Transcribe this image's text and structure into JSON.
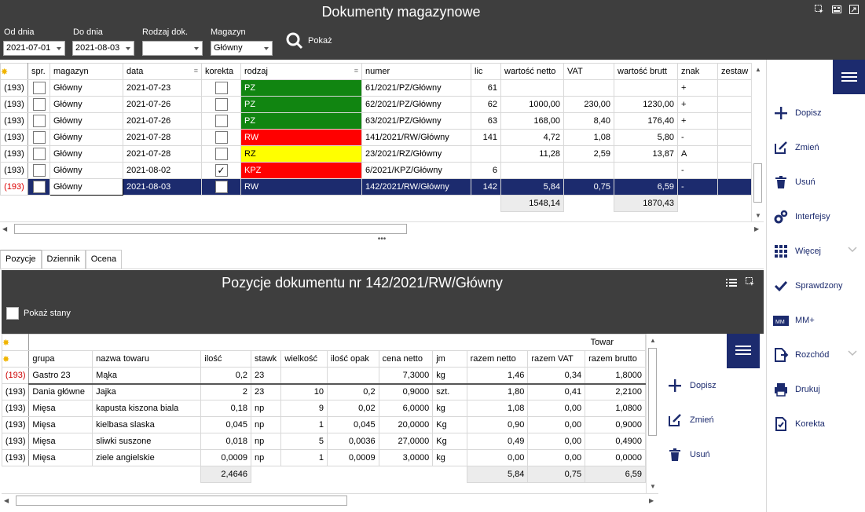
{
  "header": {
    "title": "Dokumenty magazynowe",
    "filters": {
      "from_label": "Od dnia",
      "from_value": "2021-07-01",
      "to_label": "Do dnia",
      "to_value": "2021-08-03",
      "type_label": "Rodzaj dok.",
      "type_value": "",
      "warehouse_label": "Magazyn",
      "warehouse_value": "Główny"
    },
    "show_label": "Pokaż"
  },
  "docs": {
    "columns": [
      "spr.",
      "magazyn",
      "data",
      "korekta",
      "rodzaj",
      "numer",
      "lic",
      "wartość netto",
      "VAT",
      "wartość brutt",
      "znak",
      "zestaw"
    ],
    "rows": [
      {
        "rh": "(193)",
        "magazyn": "Główny",
        "data": "2021-07-23",
        "korekta": "",
        "rodzaj": "PZ",
        "numer": "61/2021/PZ/Główny",
        "lic": "61",
        "netto": "",
        "vat": "",
        "brutto": "",
        "znak": "+"
      },
      {
        "rh": "(193)",
        "magazyn": "Główny",
        "data": "2021-07-26",
        "korekta": "",
        "rodzaj": "PZ",
        "numer": "62/2021/PZ/Główny",
        "lic": "62",
        "netto": "1000,00",
        "vat": "230,00",
        "brutto": "1230,00",
        "znak": "+"
      },
      {
        "rh": "(193)",
        "magazyn": "Główny",
        "data": "2021-07-26",
        "korekta": "",
        "rodzaj": "PZ",
        "numer": "63/2021/PZ/Główny",
        "lic": "63",
        "netto": "168,00",
        "vat": "8,40",
        "brutto": "176,40",
        "znak": "+"
      },
      {
        "rh": "(193)",
        "magazyn": "Główny",
        "data": "2021-07-28",
        "korekta": "",
        "rodzaj": "RW",
        "numer": "141/2021/RW/Główny",
        "lic": "141",
        "netto": "4,72",
        "vat": "1,08",
        "brutto": "5,80",
        "znak": "-"
      },
      {
        "rh": "(193)",
        "magazyn": "Główny",
        "data": "2021-07-28",
        "korekta": "",
        "rodzaj": "RZ",
        "numer": "23/2021/RZ/Główny",
        "lic": "",
        "netto": "11,28",
        "vat": "2,59",
        "brutto": "13,87",
        "znak": "A"
      },
      {
        "rh": "(193)",
        "magazyn": "Główny",
        "data": "2021-08-02",
        "korekta": "✓",
        "rodzaj": "KPZ",
        "numer": "6/2021/KPZ/Główny",
        "lic": "6",
        "netto": "",
        "vat": "",
        "brutto": "",
        "znak": "-"
      },
      {
        "rh": "(193)",
        "magazyn": "Główny",
        "data": "2021-08-03",
        "korekta": "",
        "rodzaj": "RW",
        "numer": "142/2021/RW/Główny",
        "lic": "142",
        "netto": "5,84",
        "vat": "0,75",
        "brutto": "6,59",
        "znak": "-"
      }
    ],
    "totals": {
      "netto": "1548,14",
      "brutto": "1870,43"
    }
  },
  "tabs": [
    "Pozycje",
    "Dziennik",
    "Ocena"
  ],
  "positions": {
    "title": "Pozycje dokumentu nr 142/2021/RW/Główny",
    "show_stock_label": "Pokaż stany",
    "group_header": "Towar",
    "columns": [
      "grupa",
      "nazwa towaru",
      "ilość",
      "stawk",
      "wielkość",
      "ilość opak",
      "cena netto",
      "jm",
      "razem netto",
      "razem VAT",
      "razem brutto"
    ],
    "rows": [
      {
        "rh": "(193)",
        "grupa": "Gastro 23",
        "nazwa": "Mąka",
        "ilosc": "0,2",
        "stawka": "23",
        "wielkosc": "",
        "opak": "",
        "cena": "7,3000",
        "jm": "kg",
        "rn": "1,46",
        "rv": "0,34",
        "rb": "1,8000"
      },
      {
        "rh": "(193)",
        "grupa": "Dania główne",
        "nazwa": "Jajka",
        "ilosc": "2",
        "stawka": "23",
        "wielkosc": "10",
        "opak": "0,2",
        "cena": "0,9000",
        "jm": "szt.",
        "rn": "1,80",
        "rv": "0,41",
        "rb": "2,2100"
      },
      {
        "rh": "(193)",
        "grupa": "Mięsa",
        "nazwa": "kapusta kiszona biala",
        "ilosc": "0,18",
        "stawka": "np",
        "wielkosc": "9",
        "opak": "0,02",
        "cena": "6,0000",
        "jm": "kg",
        "rn": "1,08",
        "rv": "0,00",
        "rb": "1,0800"
      },
      {
        "rh": "(193)",
        "grupa": "Mięsa",
        "nazwa": "kielbasa slaska",
        "ilosc": "0,045",
        "stawka": "np",
        "wielkosc": "1",
        "opak": "0,045",
        "cena": "20,0000",
        "jm": "Kg",
        "rn": "0,90",
        "rv": "0,00",
        "rb": "0,9000"
      },
      {
        "rh": "(193)",
        "grupa": "Mięsa",
        "nazwa": "sliwki suszone",
        "ilosc": "0,018",
        "stawka": "np",
        "wielkosc": "5",
        "opak": "0,0036",
        "cena": "27,0000",
        "jm": "Kg",
        "rn": "0,49",
        "rv": "0,00",
        "rb": "0,4900"
      },
      {
        "rh": "(193)",
        "grupa": "Mięsa",
        "nazwa": "ziele angielskie",
        "ilosc": "0,0009",
        "stawka": "np",
        "wielkosc": "1",
        "opak": "0,0009",
        "cena": "3,0000",
        "jm": "kg",
        "rn": "0,00",
        "rv": "0,00",
        "rb": "0,0000"
      }
    ],
    "totals": {
      "ilosc": "2,4646",
      "rn": "5,84",
      "rv": "0,75",
      "rb": "6,59"
    }
  },
  "actions": [
    "Dopisz",
    "Zmień",
    "Usuń",
    "Interfejsy",
    "Więcej",
    "Sprawdzony",
    "MM+",
    "Rozchód",
    "Drukuj",
    "Korekta"
  ],
  "sub_actions": [
    "Dopisz",
    "Zmień",
    "Usuń"
  ],
  "colors": {
    "accent": "#1c2b6e",
    "pz": "#118511",
    "rw": "#ff0000",
    "rz": "#ffff00"
  }
}
